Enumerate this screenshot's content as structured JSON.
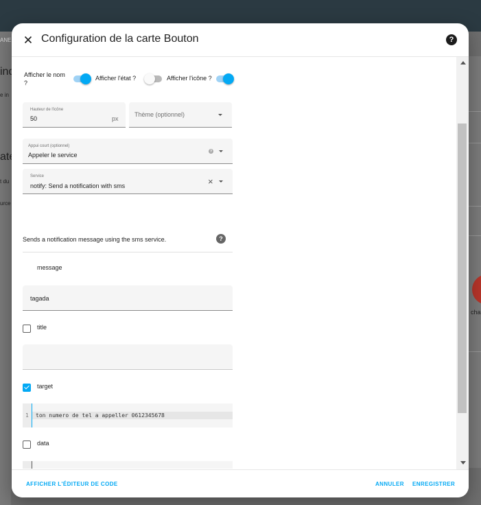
{
  "background": {
    "topbar_text": "ANE",
    "left_texts": [
      "ind",
      "e in",
      "ate",
      "t du",
      "urce"
    ],
    "right_text": "cha"
  },
  "dialog": {
    "title": "Configuration de la carte Bouton",
    "toggles": {
      "show_name": {
        "label": "Afficher le nom ?",
        "on": true
      },
      "show_state": {
        "label": "Afficher l'état ?",
        "on": false
      },
      "show_icon": {
        "label": "Afficher l'icône ?",
        "on": true
      }
    },
    "icon_height": {
      "label": "Hauteur de l'icône",
      "value": "50",
      "unit": "px"
    },
    "theme": {
      "placeholder": "Thème (optionnel)"
    },
    "tap_action": {
      "label": "Appui court (optionnel)",
      "value": "Appeler le service"
    },
    "service": {
      "label": "Service",
      "value": "notify: Send a notification with sms"
    },
    "service_description": "Sends a notification message using the sms service.",
    "params": {
      "message": {
        "label": "message",
        "value": "tagada"
      },
      "title": {
        "label": "title",
        "checked": false,
        "value": ""
      },
      "target": {
        "label": "target",
        "checked": true,
        "line_no": "1",
        "code": "ton numero de tel a appeller 0612345678"
      },
      "data": {
        "label": "data",
        "checked": false,
        "line_no": "1",
        "code": ""
      }
    },
    "footer": {
      "show_code_editor": "AFFICHER L'ÉDITEUR DE CODE",
      "cancel": "ANNULER",
      "save": "ENREGISTRER"
    }
  },
  "colors": {
    "accent": "#03a9f4",
    "header_bg": "#2b3a42"
  }
}
